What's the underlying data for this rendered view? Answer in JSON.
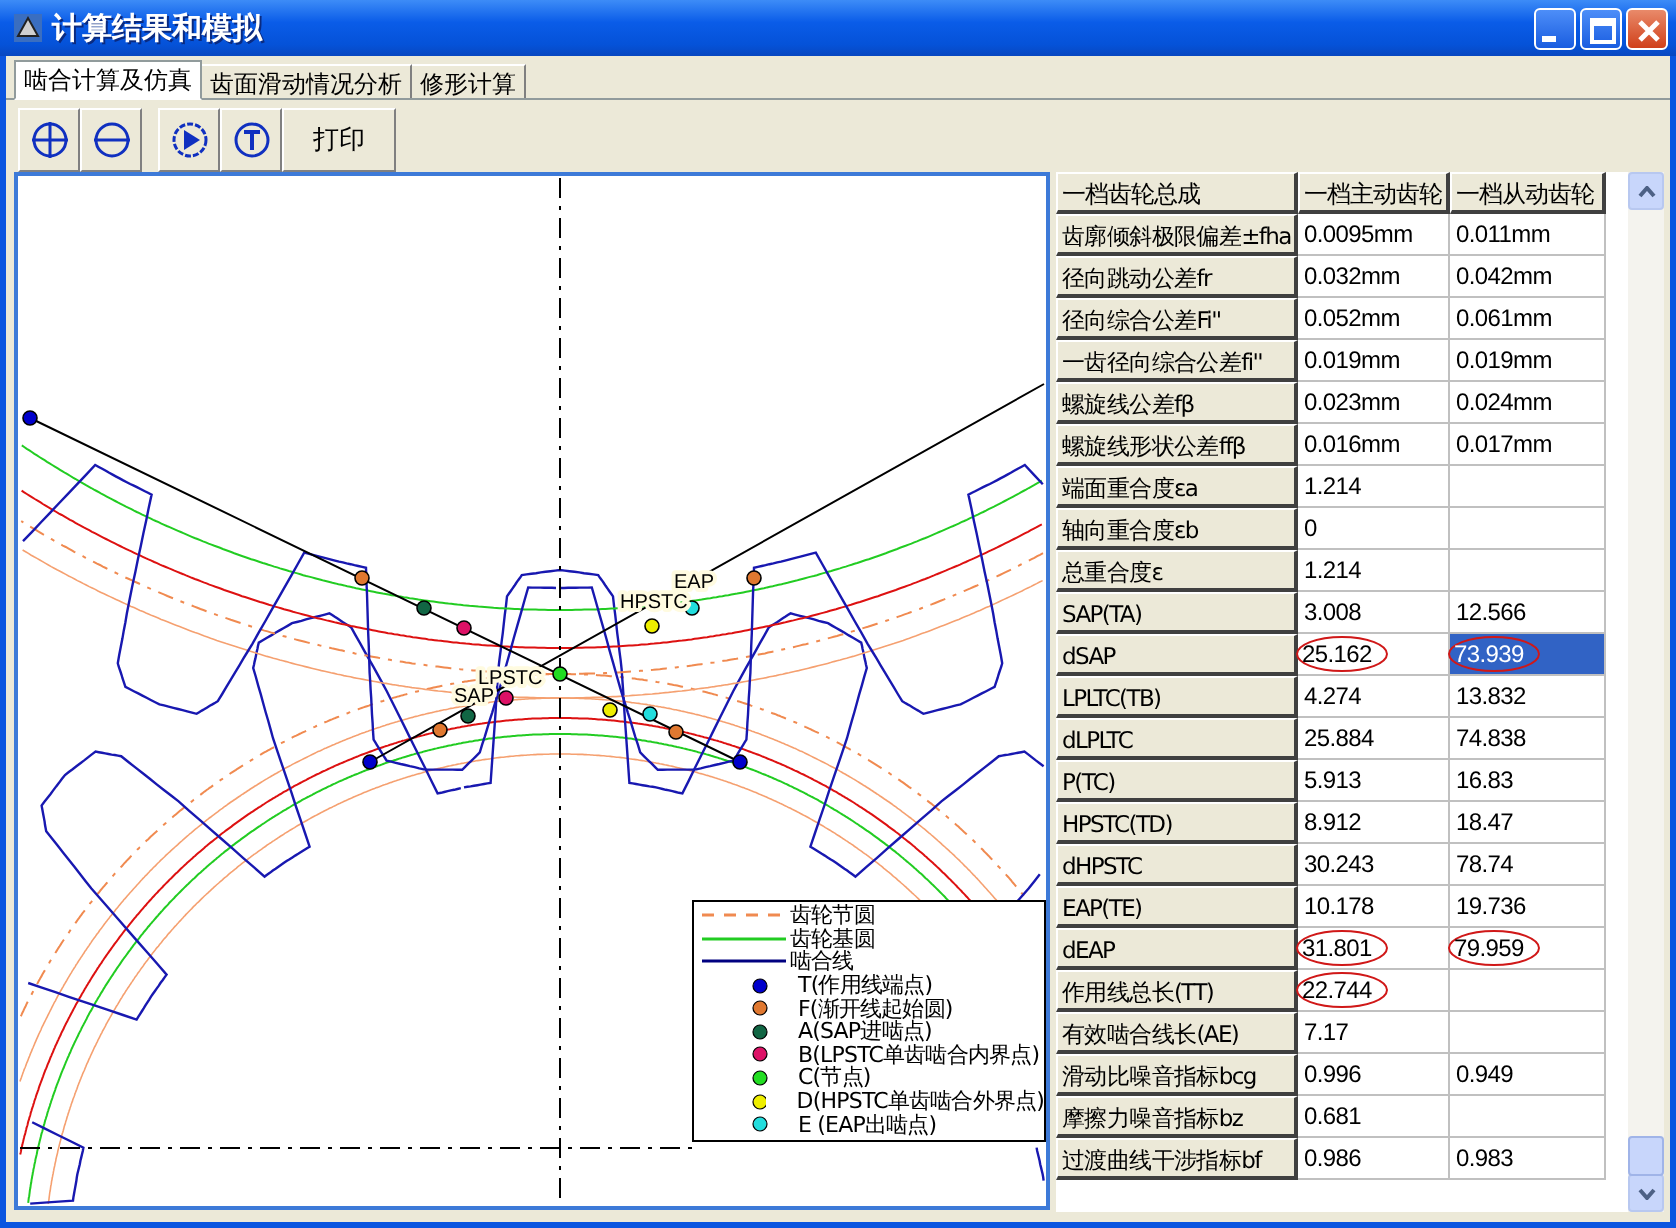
{
  "window": {
    "title": "计算结果和模拟"
  },
  "tabs": [
    {
      "label": "啮合计算及仿真",
      "selected": true
    },
    {
      "label": "齿面滑动情况分析",
      "selected": false
    },
    {
      "label": "修形计算",
      "selected": false
    }
  ],
  "toolbar": {
    "print_label": "打印"
  },
  "drawing": {
    "point_labels": [
      "EAP",
      "HPSTC",
      "LPSTC",
      "SAP"
    ],
    "legend": [
      {
        "kind": "dashed",
        "color": "#f08a50",
        "label": "齿轮节圆"
      },
      {
        "kind": "solid",
        "color": "#22cc22",
        "label": "齿轮基圆"
      },
      {
        "kind": "solid",
        "color": "#000080",
        "label": "啮合线"
      },
      {
        "kind": "dot",
        "color": "#0000cc",
        "label": "T(作用线端点)"
      },
      {
        "kind": "dot",
        "color": "#e07830",
        "label": "F(渐开线起始圆)"
      },
      {
        "kind": "dot",
        "color": "#116644",
        "label": "A(SAP进啮点)"
      },
      {
        "kind": "dot",
        "color": "#dd1166",
        "label": "B(LPSTC单齿啮合内界点)"
      },
      {
        "kind": "dot",
        "color": "#22dd22",
        "label": "C(节点)"
      },
      {
        "kind": "dot",
        "color": "#eeee00",
        "label": "D(HPSTC单齿啮合外界点)"
      },
      {
        "kind": "dot",
        "color": "#22dddd",
        "label": "E (EAP出啮点)"
      }
    ]
  },
  "table": {
    "columns": [
      "一档齿轮总成",
      "一档主动齿轮",
      "一档从动齿轮"
    ],
    "rows": [
      {
        "label": "齿廓倾斜极限偏差±fha",
        "values": [
          {
            "text": "0.0095mm",
            "circled": false,
            "selected": false
          },
          {
            "text": "0.011mm",
            "circled": false,
            "selected": false
          }
        ]
      },
      {
        "label": "径向跳动公差fr",
        "values": [
          {
            "text": "0.032mm",
            "circled": false,
            "selected": false
          },
          {
            "text": "0.042mm",
            "circled": false,
            "selected": false
          }
        ]
      },
      {
        "label": "径向综合公差Fi''",
        "values": [
          {
            "text": "0.052mm",
            "circled": false,
            "selected": false
          },
          {
            "text": "0.061mm",
            "circled": false,
            "selected": false
          }
        ]
      },
      {
        "label": "一齿径向综合公差fi''",
        "values": [
          {
            "text": "0.019mm",
            "circled": false,
            "selected": false
          },
          {
            "text": "0.019mm",
            "circled": false,
            "selected": false
          }
        ]
      },
      {
        "label": "螺旋线公差fβ",
        "values": [
          {
            "text": "0.023mm",
            "circled": false,
            "selected": false
          },
          {
            "text": "0.024mm",
            "circled": false,
            "selected": false
          }
        ]
      },
      {
        "label": "螺旋线形状公差ffβ",
        "values": [
          {
            "text": "0.016mm",
            "circled": false,
            "selected": false
          },
          {
            "text": "0.017mm",
            "circled": false,
            "selected": false
          }
        ]
      },
      {
        "label": "端面重合度εa",
        "values": [
          {
            "text": "1.214",
            "circled": false,
            "selected": false
          }
        ]
      },
      {
        "label": "轴向重合度εb",
        "values": [
          {
            "text": "0",
            "circled": false,
            "selected": false
          }
        ]
      },
      {
        "label": "总重合度ε",
        "values": [
          {
            "text": "1.214",
            "circled": false,
            "selected": false
          }
        ]
      },
      {
        "label": "SAP(TA)",
        "values": [
          {
            "text": "3.008",
            "circled": false,
            "selected": false
          },
          {
            "text": "12.566",
            "circled": false,
            "selected": false
          }
        ]
      },
      {
        "label": "dSAP",
        "values": [
          {
            "text": "25.162",
            "circled": true,
            "selected": false
          },
          {
            "text": "73.939",
            "circled": true,
            "selected": true
          }
        ]
      },
      {
        "label": "LPLTC(TB)",
        "values": [
          {
            "text": "4.274",
            "circled": false,
            "selected": false
          },
          {
            "text": "13.832",
            "circled": false,
            "selected": false
          }
        ]
      },
      {
        "label": "dLPLTC",
        "values": [
          {
            "text": "25.884",
            "circled": false,
            "selected": false
          },
          {
            "text": "74.838",
            "circled": false,
            "selected": false
          }
        ]
      },
      {
        "label": "P(TC)",
        "values": [
          {
            "text": "5.913",
            "circled": false,
            "selected": false
          },
          {
            "text": "16.83",
            "circled": false,
            "selected": false
          }
        ]
      },
      {
        "label": "HPSTC(TD)",
        "values": [
          {
            "text": "8.912",
            "circled": false,
            "selected": false
          },
          {
            "text": "18.47",
            "circled": false,
            "selected": false
          }
        ]
      },
      {
        "label": "dHPSTC",
        "values": [
          {
            "text": "30.243",
            "circled": false,
            "selected": false
          },
          {
            "text": "78.74",
            "circled": false,
            "selected": false
          }
        ]
      },
      {
        "label": "EAP(TE)",
        "values": [
          {
            "text": "10.178",
            "circled": false,
            "selected": false
          },
          {
            "text": "19.736",
            "circled": false,
            "selected": false
          }
        ]
      },
      {
        "label": "dEAP",
        "values": [
          {
            "text": "31.801",
            "circled": true,
            "selected": false
          },
          {
            "text": "79.959",
            "circled": true,
            "selected": false
          }
        ]
      },
      {
        "label": "作用线总长(TT)",
        "values": [
          {
            "text": "22.744",
            "circled": true,
            "selected": false
          }
        ]
      },
      {
        "label": "有效啮合线长(AE)",
        "values": [
          {
            "text": "7.17",
            "circled": false,
            "selected": false
          }
        ]
      },
      {
        "label": "滑动比噪音指标bcg",
        "values": [
          {
            "text": "0.996",
            "circled": false,
            "selected": false
          },
          {
            "text": "0.949",
            "circled": false,
            "selected": false
          }
        ]
      },
      {
        "label": "摩擦力噪音指标bz",
        "values": [
          {
            "text": "0.681",
            "circled": false,
            "selected": false
          }
        ]
      },
      {
        "label": "过渡曲线干涉指标bf",
        "values": [
          {
            "text": "0.986",
            "circled": false,
            "selected": false
          },
          {
            "text": "0.983",
            "circled": false,
            "selected": false
          }
        ]
      }
    ]
  }
}
